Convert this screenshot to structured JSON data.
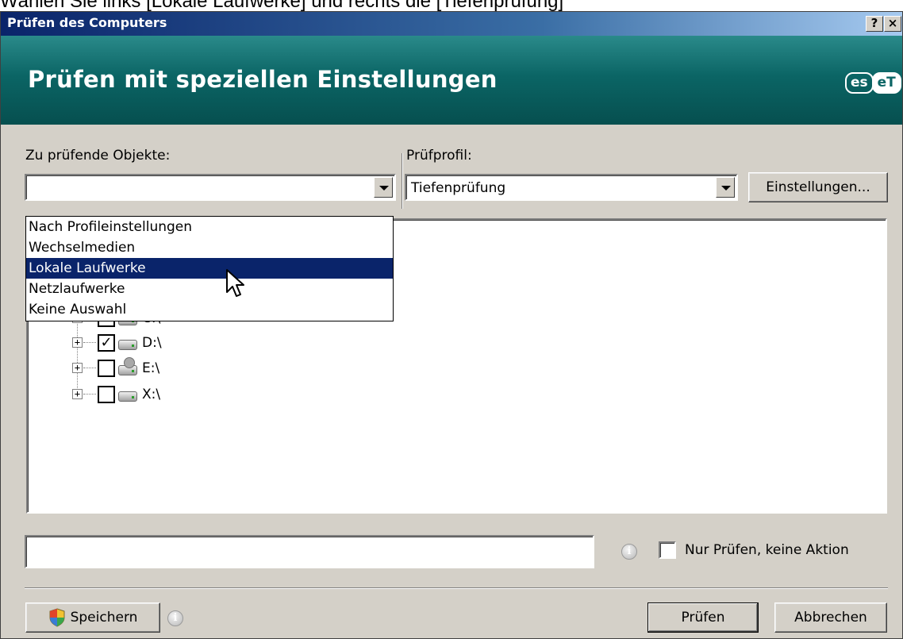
{
  "instruction": "Wählen Sie links [Lokale Laufwerke] und rechts die [Tiefenprüfung]",
  "window": {
    "title": "Prüfen des Computers",
    "help_label": "?",
    "close_label": "×"
  },
  "header": {
    "title": "Prüfen mit speziellen Einstellungen",
    "logo_left": "es",
    "logo_right": "eT"
  },
  "targets": {
    "label": "Zu prüfende Objekte:",
    "value": "",
    "options": [
      "Nach Profileinstellungen",
      "Wechselmedien",
      "Lokale Laufwerke",
      "Netzlaufwerke",
      "Keine Auswahl"
    ],
    "selected_index": 2
  },
  "profile": {
    "label": "Prüfprofil:",
    "value": "Tiefenprüfung",
    "settings_button": "Einstellungen..."
  },
  "tree": {
    "drives": [
      {
        "label": "C:\\",
        "checked": true
      },
      {
        "label": "D:\\",
        "checked": true
      },
      {
        "label": "E:\\",
        "checked": false
      },
      {
        "label": "X:\\",
        "checked": false
      }
    ]
  },
  "path_field": {
    "value": ""
  },
  "scan_only": {
    "label": "Nur Prüfen, keine Aktion",
    "checked": false
  },
  "buttons": {
    "save": "Speichern",
    "scan": "Prüfen",
    "cancel": "Abbrechen"
  }
}
